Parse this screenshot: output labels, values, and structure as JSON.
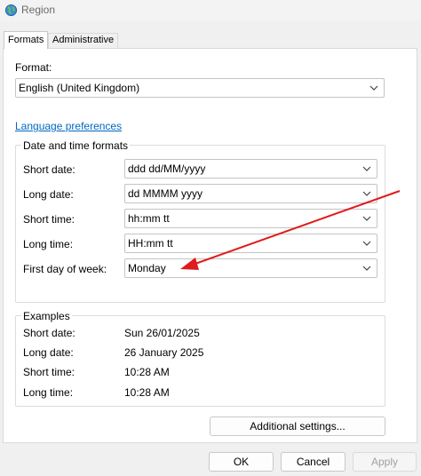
{
  "window": {
    "title": "Region",
    "icon": "globe-icon"
  },
  "tabs": [
    {
      "label": "Formats",
      "active": true
    },
    {
      "label": "Administrative",
      "active": false
    }
  ],
  "format": {
    "label": "Format:",
    "value": "English (United Kingdom)"
  },
  "language_link": "Language preferences",
  "date_time_formats": {
    "title": "Date and time formats",
    "rows": [
      {
        "label": "Short date:",
        "value": "ddd dd/MM/yyyy"
      },
      {
        "label": "Long date:",
        "value": "dd MMMM yyyy"
      },
      {
        "label": "Short time:",
        "value": "hh:mm tt"
      },
      {
        "label": "Long time:",
        "value": "HH:mm tt"
      },
      {
        "label": "First day of week:",
        "value": "Monday"
      }
    ]
  },
  "examples": {
    "title": "Examples",
    "rows": [
      {
        "label": "Short date:",
        "value": "Sun 26/01/2025"
      },
      {
        "label": "Long date:",
        "value": "26 January 2025"
      },
      {
        "label": "Short time:",
        "value": "10:28 AM"
      },
      {
        "label": "Long time:",
        "value": "10:28 AM"
      }
    ]
  },
  "buttons": {
    "additional_settings": "Additional settings...",
    "ok": "OK",
    "cancel": "Cancel",
    "apply": "Apply"
  },
  "colors": {
    "link": "#0067c0",
    "annotation_arrow": "#e01b1b"
  }
}
